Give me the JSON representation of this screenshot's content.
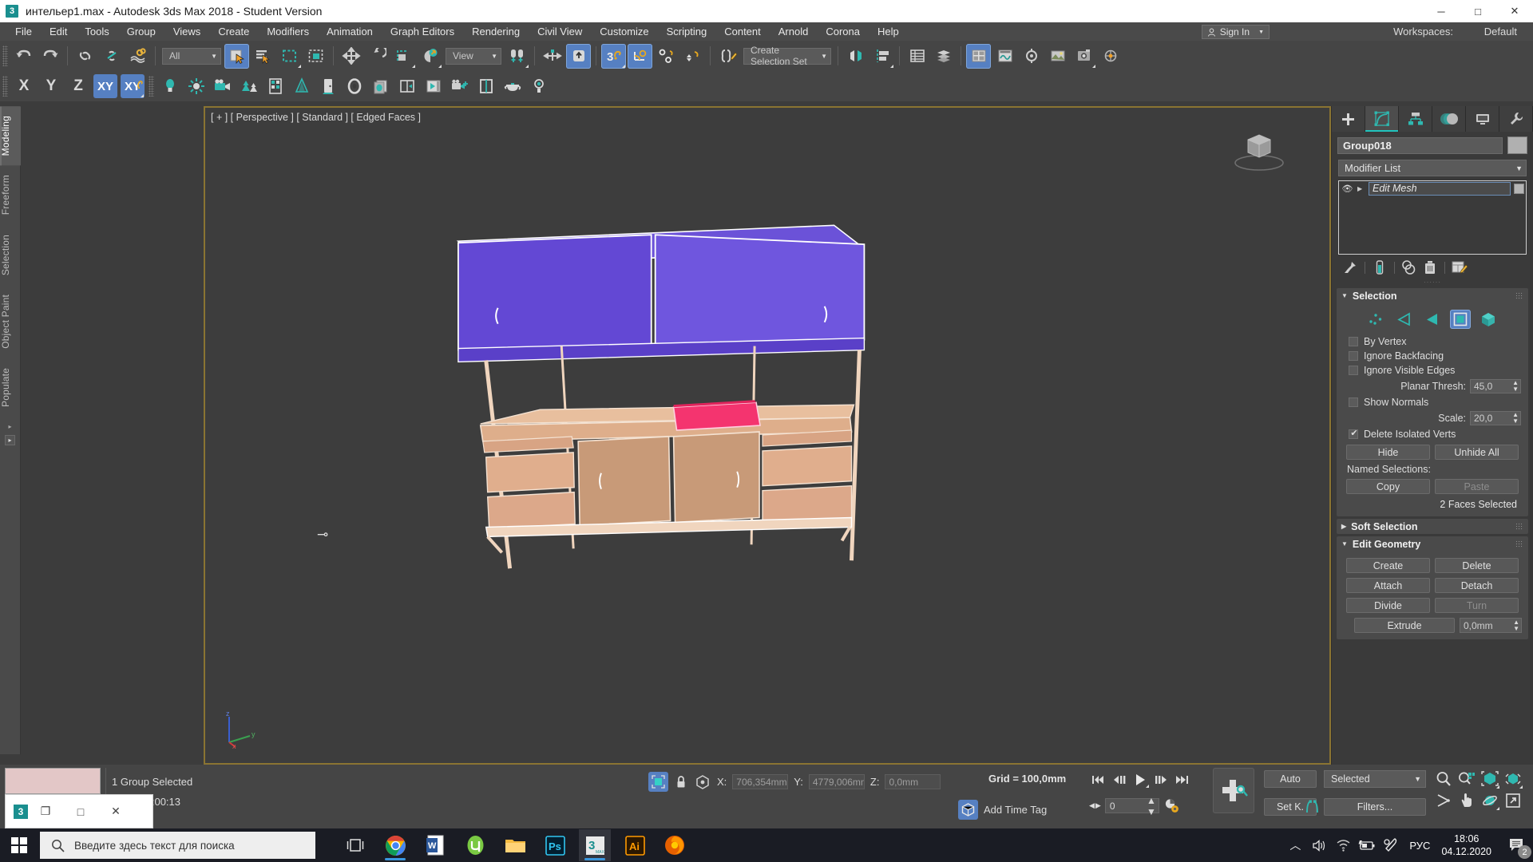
{
  "window": {
    "title": "интельер1.max - Autodesk 3ds Max 2018 - Student Version",
    "app_icon": "3",
    "minimize": "─",
    "maximize": "□",
    "close": "✕"
  },
  "menubar": {
    "items": [
      {
        "label": "File"
      },
      {
        "label": "Edit"
      },
      {
        "label": "Tools"
      },
      {
        "label": "Group"
      },
      {
        "label": "Views"
      },
      {
        "label": "Create"
      },
      {
        "label": "Modifiers"
      },
      {
        "label": "Animation"
      },
      {
        "label": "Graph Editors"
      },
      {
        "label": "Rendering"
      },
      {
        "label": "Civil View"
      },
      {
        "label": "Customize"
      },
      {
        "label": "Scripting"
      },
      {
        "label": "Content"
      },
      {
        "label": "Arnold"
      },
      {
        "label": "Corona"
      },
      {
        "label": "Help"
      }
    ],
    "sign_in": "Sign In",
    "workspaces_label": "Workspaces:",
    "workspaces_value": "Default"
  },
  "toolbar_main": {
    "selection_filter": "All",
    "reference_coord": "View",
    "selection_set": "Create Selection Set",
    "icons": [
      "undo-icon",
      "redo-icon",
      "select-link-icon",
      "unlink-icon",
      "bind-space-warp-icon",
      "select-object-icon",
      "select-by-name-icon",
      "rectangular-select-icon",
      "window-crossing-icon",
      "select-move-icon",
      "select-rotate-icon",
      "select-scale-icon",
      "select-place-icon",
      "use-center-icon",
      "mirror-icon",
      "align-icon",
      "snaps-toggle-icon",
      "angle-snap-icon",
      "percent-snap-icon",
      "spinner-snap-icon",
      "named-selection-sets-icon",
      "mirror-tool-icon",
      "align-tool-icon",
      "layer-manager-icon",
      "scene-explorer-icon",
      "curve-editor-icon",
      "schematic-view-icon",
      "material-editor-icon",
      "render-setup-icon",
      "rendered-frame-icon",
      "render-production-icon"
    ]
  },
  "toolbar_axis": {
    "axis_constraints": [
      "X",
      "Y",
      "Z",
      "XY",
      "XY+"
    ],
    "active_constraint": "XY",
    "create_icons": [
      "omni-light-icon",
      "free-light-icon",
      "camera-icon",
      "foliage-icon",
      "wall-icon",
      "tree-icon",
      "door-icon",
      "torus-icon",
      "plane-array-icon",
      "viewport-layout-icon",
      "preview-icon",
      "camera-match-icon",
      "window-icon",
      "teapot-icon",
      "light-bulb-icon"
    ]
  },
  "ribbon": {
    "tabs": [
      {
        "label": "Modeling",
        "active": true
      },
      {
        "label": "Freeform",
        "active": false
      },
      {
        "label": "Selection",
        "active": false
      },
      {
        "label": "Object Paint",
        "active": false
      },
      {
        "label": "Populate",
        "active": false
      }
    ]
  },
  "viewport": {
    "label": "[ + ] [ Perspective ] [ Standard ] [ Edged Faces ]",
    "border_color": "#8a7432",
    "background": "#3d3d3d",
    "axis_labels": {
      "z": "z",
      "y": "y",
      "x": "x"
    },
    "model": {
      "upper_cabinet_color": "#6b52d8",
      "frame_color": "#f0d5be",
      "panel_color": "#c89a78",
      "selected_face_color": "#f4346f"
    },
    "viewcube": "viewcube-icon"
  },
  "command_panel": {
    "tabs": [
      {
        "name": "create-tab",
        "icon": "plus-icon",
        "active": false
      },
      {
        "name": "modify-tab",
        "icon": "modify-icon",
        "active": true
      },
      {
        "name": "hierarchy-tab",
        "icon": "hierarchy-icon",
        "active": false
      },
      {
        "name": "motion-tab",
        "icon": "motion-icon",
        "active": false
      },
      {
        "name": "display-tab",
        "icon": "display-icon",
        "active": false
      },
      {
        "name": "utilities-tab",
        "icon": "wrench-icon",
        "active": false
      }
    ],
    "object_name": "Group018",
    "object_color": "#b0b0b0",
    "modifier_list_label": "Modifier List",
    "modifier_stack": [
      {
        "name": "Edit Mesh",
        "visible": true
      }
    ],
    "stack_tools": [
      "pin-stack-icon",
      "show-end-result-icon",
      "make-unique-icon",
      "remove-modifier-icon",
      "configure-modifier-sets-icon"
    ],
    "selection_rollout": {
      "title": "Selection",
      "expanded": true,
      "sub_object_levels": [
        {
          "name": "vertex",
          "active": false
        },
        {
          "name": "edge",
          "active": false
        },
        {
          "name": "face",
          "active": false
        },
        {
          "name": "polygon",
          "active": true
        },
        {
          "name": "element",
          "active": false
        }
      ],
      "by_vertex": {
        "label": "By Vertex",
        "checked": false
      },
      "ignore_backfacing": {
        "label": "Ignore Backfacing",
        "checked": false
      },
      "ignore_visible_edges": {
        "label": "Ignore Visible Edges",
        "checked": false
      },
      "planar_thresh": {
        "label": "Planar Thresh:",
        "value": "45,0"
      },
      "show_normals": {
        "label": "Show Normals",
        "checked": false
      },
      "scale": {
        "label": "Scale:",
        "value": "20,0"
      },
      "delete_isolated_verts": {
        "label": "Delete Isolated Verts",
        "checked": true
      },
      "hide_button": "Hide",
      "unhide_all_button": "Unhide All",
      "named_selections_label": "Named Selections:",
      "copy_button": "Copy",
      "paste_button": "Paste",
      "status": "2 Faces Selected"
    },
    "soft_selection_rollout": {
      "title": "Soft Selection",
      "expanded": false
    },
    "edit_geometry_rollout": {
      "title": "Edit Geometry",
      "expanded": true,
      "buttons": [
        {
          "label": "Create",
          "disabled": false
        },
        {
          "label": "Delete",
          "disabled": false
        },
        {
          "label": "Attach",
          "disabled": false
        },
        {
          "label": "Detach",
          "disabled": false
        },
        {
          "label": "Divide",
          "disabled": false
        },
        {
          "label": "Turn",
          "disabled": true
        }
      ],
      "extrude_label": "Extrude",
      "extrude_value": "0,0mm"
    }
  },
  "status_bar": {
    "material_swatch_color": "#e3c7c7",
    "selection_status": "1 Group Selected",
    "time_status": "g Time  0:00:13",
    "coords": {
      "x_label": "X:",
      "x_value": "706,354mm",
      "y_label": "Y:",
      "y_value": "4779,006mm",
      "z_label": "Z:",
      "z_value": "0,0mm"
    },
    "grid": "Grid = 100,0mm",
    "add_time_tag": "Add Time Tag",
    "frame_value": "0",
    "auto_key": "Auto",
    "set_key": "Set K.",
    "key_filter_mode": "Selected",
    "filters_button": "Filters...",
    "playback_icons": [
      "go-to-start-icon",
      "previous-frame-icon",
      "play-animation-icon",
      "next-frame-icon",
      "go-to-end-icon"
    ],
    "nav_icons": [
      "zoom-icon",
      "zoom-all-icon",
      "zoom-extents-icon",
      "zoom-region-icon",
      "field-of-view-icon",
      "pan-icon",
      "orbit-icon",
      "maximize-viewport-icon"
    ]
  },
  "mini_window": {
    "icon": "3",
    "minimize": "❐",
    "maximize": "□",
    "close": "✕"
  },
  "taskbar": {
    "start_icon": "windows-start-icon",
    "search_placeholder": "Введите здесь текст для поиска",
    "search_icon": "search-icon",
    "task_view_icon": "task-view-icon",
    "apps": [
      {
        "name": "chrome-icon",
        "running": true,
        "active": false
      },
      {
        "name": "word-icon",
        "running": false,
        "active": false
      },
      {
        "name": "utorrent-icon",
        "running": false,
        "active": false
      },
      {
        "name": "file-explorer-icon",
        "running": false,
        "active": false
      },
      {
        "name": "photoshop-icon",
        "running": false,
        "active": false
      },
      {
        "name": "3dsmax-icon",
        "running": true,
        "active": true
      },
      {
        "name": "illustrator-icon",
        "running": false,
        "active": false
      },
      {
        "name": "firefox-icon",
        "running": false,
        "active": false
      }
    ],
    "tray": {
      "show_hidden_icon": "chevron-up-icon",
      "volume_icon": "speaker-icon",
      "network_icon": "wifi-icon",
      "battery_icon": "battery-charging-icon",
      "pen_icon": "windows-ink-icon",
      "language": "РУС",
      "time": "18:06",
      "date": "04.12.2020",
      "notification_count": "2"
    }
  }
}
